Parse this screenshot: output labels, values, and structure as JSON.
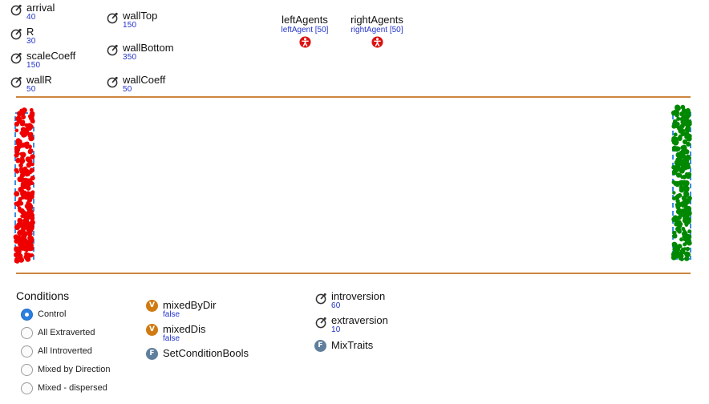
{
  "parameters_left": [
    {
      "name": "arrival",
      "value": "40"
    },
    {
      "name": "R",
      "value": "30"
    },
    {
      "name": "scaleCoeff",
      "value": "150"
    },
    {
      "name": "wallR",
      "value": "50"
    }
  ],
  "parameters_mid": [
    {
      "name": "wallTop",
      "value": "150"
    },
    {
      "name": "wallBottom",
      "value": "350"
    },
    {
      "name": "wallCoeff",
      "value": "50"
    }
  ],
  "populations": [
    {
      "name": "leftAgents",
      "sub": "leftAgent [50]"
    },
    {
      "name": "rightAgents",
      "sub": "rightAgent [50]"
    }
  ],
  "colors": {
    "wall": "#cd853f",
    "left_agents": "#ee0000",
    "right_agents": "#008800",
    "spawn_area": "#3a8de0",
    "value_text": "#2233cc",
    "variable_badge": "#d07a12",
    "function_badge": "#5f7f9c",
    "radio_selected": "#2a7fe0"
  },
  "conditions": {
    "title": "Conditions",
    "selected_index": 0,
    "options": [
      "Control",
      "All Extraverted",
      "All Introverted",
      "Mixed by Direction",
      "Mixed - dispersed"
    ]
  },
  "variables": [
    {
      "badge": "V",
      "name": "mixedByDir",
      "value": "false"
    },
    {
      "badge": "V",
      "name": "mixedDis",
      "value": "false"
    }
  ],
  "functions": [
    {
      "badge": "F",
      "name": "SetConditionBools"
    },
    {
      "badge": "F",
      "name": "MixTraits"
    }
  ],
  "parameters_right": [
    {
      "name": "introversion",
      "value": "60"
    },
    {
      "name": "extraversion",
      "value": "10"
    }
  ],
  "icons": {
    "parameter": "parameter-icon",
    "population": "agent-population-icon",
    "variable": "variable-icon",
    "function": "function-icon"
  }
}
